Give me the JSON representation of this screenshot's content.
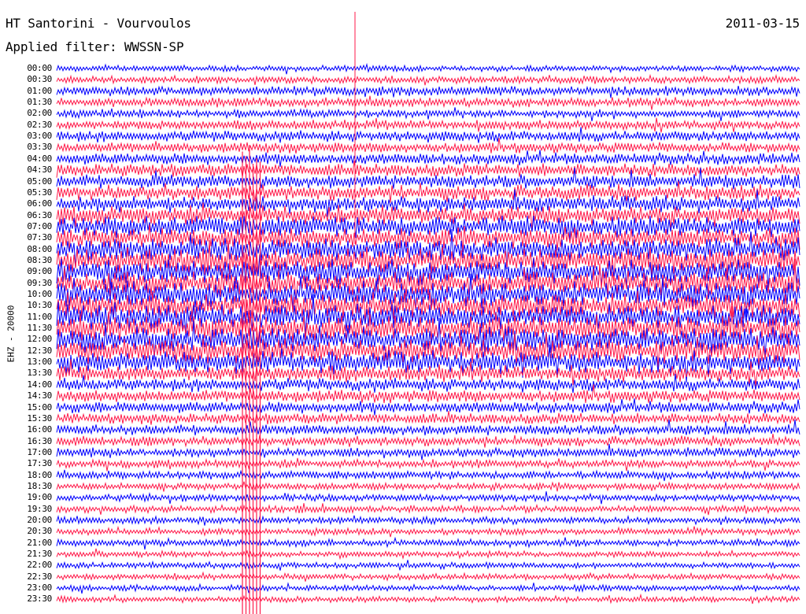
{
  "header": {
    "station": "HT Santorini - Vourvoulos",
    "filter": "Applied filter: WWSSN-SP",
    "date": "2011-03-15"
  },
  "channel": "EHZ - 20000",
  "colors": {
    "trace_a": "#0000ff",
    "trace_b": "#ff1a4a",
    "background": "#ffffff"
  },
  "chart_data": {
    "type": "line",
    "rows": [
      "00:00",
      "00:30",
      "01:00",
      "01:30",
      "02:00",
      "02:30",
      "03:00",
      "03:30",
      "04:00",
      "04:30",
      "05:00",
      "05:30",
      "06:00",
      "06:30",
      "07:00",
      "07:30",
      "08:00",
      "08:30",
      "09:00",
      "09:30",
      "10:00",
      "10:30",
      "11:00",
      "11:30",
      "12:00",
      "12:30",
      "13:00",
      "13:30",
      "14:00",
      "14:30",
      "15:00",
      "15:30",
      "16:00",
      "16:30",
      "17:00",
      "17:30",
      "18:00",
      "18:30",
      "19:00",
      "19:30",
      "20:00",
      "20:30",
      "21:00",
      "21:30",
      "22:00",
      "22:30",
      "23:00",
      "23:30"
    ],
    "row_minutes": 30,
    "relative_amplitude": [
      0.15,
      0.2,
      0.3,
      0.3,
      0.25,
      0.3,
      0.35,
      0.35,
      0.4,
      0.45,
      0.5,
      0.55,
      0.6,
      0.7,
      0.85,
      0.8,
      0.9,
      1.0,
      1.0,
      1.0,
      1.0,
      1.0,
      1.0,
      1.0,
      1.0,
      1.0,
      0.9,
      0.6,
      0.45,
      0.45,
      0.4,
      0.35,
      0.35,
      0.3,
      0.3,
      0.25,
      0.25,
      0.2,
      0.2,
      0.2,
      0.2,
      0.18,
      0.18,
      0.15,
      0.15,
      0.15,
      0.15,
      0.15
    ]
  }
}
